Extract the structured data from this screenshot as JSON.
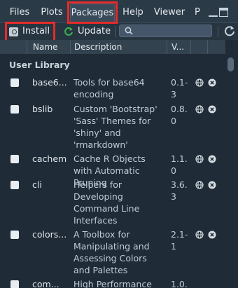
{
  "tabs": {
    "files": "Files",
    "plots": "Plots",
    "packages": "Packages",
    "help": "Help",
    "viewer": "Viewer",
    "presentation": "P"
  },
  "toolbar": {
    "install": "Install",
    "update": "Update",
    "search_placeholder": ""
  },
  "columns": {
    "name": "Name",
    "description": "Description",
    "version": "V..."
  },
  "section_label": "User Library",
  "packages": [
    {
      "name": "base6...",
      "description": "Tools for base64 encoding",
      "version": "0.1-3"
    },
    {
      "name": "bslib",
      "description": "Custom 'Bootstrap' 'Sass' Themes for 'shiny' and 'rmarkdown'",
      "version": "0.8.0"
    },
    {
      "name": "cachem",
      "description": "Cache R Objects with Automatic Pruning",
      "version": "1.1.0"
    },
    {
      "name": "cli",
      "description": "Helpers for Developing Command Line Interfaces",
      "version": "3.6.3"
    },
    {
      "name": "colors...",
      "description": "A Toolbox for Manipulating and Assessing Colors and Palettes",
      "version": "2.1-1"
    },
    {
      "name": "com...",
      "description": "High Performance",
      "version": "1.0.1"
    }
  ],
  "colors": {
    "highlight": "#e52b2b",
    "update_icon": "#3fb24f",
    "background": "#1f2b36"
  }
}
